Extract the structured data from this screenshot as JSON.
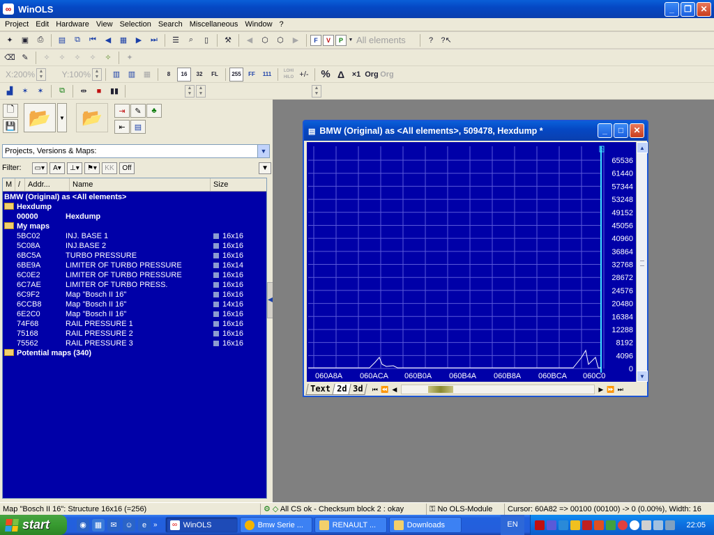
{
  "app": {
    "title": "WinOLS"
  },
  "menu": [
    "Project",
    "Edit",
    "Hardware",
    "View",
    "Selection",
    "Search",
    "Miscellaneous",
    "Window",
    "?"
  ],
  "toolbar": {
    "all_elements": "All elements",
    "x_zoom": "X:200%",
    "y_zoom": "Y:100%",
    "bits": [
      "8",
      "16",
      "32",
      "FL"
    ],
    "hex_labels": [
      "255",
      "FF",
      "111"
    ],
    "lohi": "LOHI\nHILO",
    "pct": "%",
    "delta": "Δ",
    "x1": "×1",
    "org": "Org",
    "org2": "Org"
  },
  "left_panel": {
    "combo": "Projects, Versions & Maps:",
    "filter_label": "Filter:",
    "filter_off": "Off",
    "columns": [
      "M",
      "/",
      "Addr...",
      "Name",
      "Size"
    ],
    "root": "BMW (Original) as <All elements>",
    "folders": {
      "hexdump": "Hexdump",
      "mymaps": "My maps",
      "potential": "Potential maps (340)"
    },
    "hexdump_row": {
      "addr": "00000",
      "name": "Hexdump"
    },
    "maps": [
      {
        "addr": "5BC02",
        "name": "INJ. BASE 1",
        "size": "16x16"
      },
      {
        "addr": "5C08A",
        "name": "INJ.BASE 2",
        "size": "16x16"
      },
      {
        "addr": "6BC5A",
        "name": "TURBO PRESSURE",
        "size": "16x16"
      },
      {
        "addr": "6BE9A",
        "name": "LIMITER OF TURBO PRESSURE",
        "size": "16x14"
      },
      {
        "addr": "6C0E2",
        "name": "LIMITER OF TURBO PRESSURE",
        "size": "16x16"
      },
      {
        "addr": "6C7AE",
        "name": "LIMITER OF TURBO PRESS.",
        "size": "16x16"
      },
      {
        "addr": "6C9F2",
        "name": "Map \"Bosch II 16\"",
        "size": "16x16"
      },
      {
        "addr": "6CCB8",
        "name": "Map \"Bosch II 16\"",
        "size": "14x16"
      },
      {
        "addr": "6E2C0",
        "name": "Map \"Bosch II 16\"",
        "size": "16x16"
      },
      {
        "addr": "74F68",
        "name": "RAIL PRESSURE 1",
        "size": "16x16"
      },
      {
        "addr": "75168",
        "name": "RAIL PRESSURE 2",
        "size": "16x16"
      },
      {
        "addr": "75562",
        "name": "RAIL PRESSURE 3",
        "size": "16x16"
      }
    ]
  },
  "child_window": {
    "title": "BMW (Original) as <All elements>, 509478, Hexdump *",
    "tabs": [
      "Text",
      "2d",
      "3d"
    ]
  },
  "chart_data": {
    "type": "line",
    "x_tick_labels": [
      "060A8A",
      "060ACA",
      "060B0A",
      "060B4A",
      "060B8A",
      "060BCA",
      "060C0"
    ],
    "y_tick_labels": [
      "65536",
      "61440",
      "57344",
      "53248",
      "49152",
      "45056",
      "40960",
      "36864",
      "32768",
      "28672",
      "24576",
      "20480",
      "16384",
      "12288",
      "8192",
      "4096",
      "0"
    ],
    "ylim": [
      0,
      65536
    ],
    "y_marker": "0",
    "grid": true,
    "colors": {
      "background": "#0000a8",
      "line": "#ffffff",
      "grid": "#5a5ad8"
    }
  },
  "status": {
    "left": "Map \"Bosch II 16\": Structure 16x16 (=256)",
    "checksum": "All CS ok - Checksum block 2 : okay",
    "module": "No OLS-Module",
    "cursor": "Cursor: 60A82 => 00100 (00100) -> 0 (0.00%), Width: 16"
  },
  "taskbar": {
    "start": "start",
    "tasks": [
      "WinOLS",
      "Bmw Serie ...",
      "RENAULT ...",
      "Downloads"
    ],
    "lang": "EN",
    "clock": "22:05"
  }
}
